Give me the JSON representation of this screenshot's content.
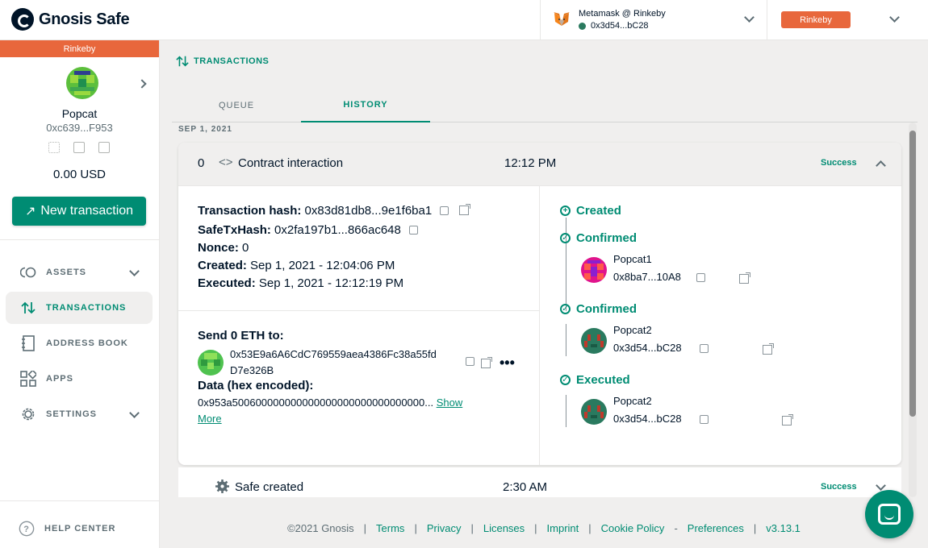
{
  "header": {
    "brand": "Gnosis Safe",
    "wallet_name": "Metamask @ Rinkeby",
    "wallet_address": "0x3d54...bC28",
    "network_badge": "Rinkeby"
  },
  "sidebar": {
    "network": "Rinkeby",
    "safe_name": "Popcat",
    "safe_address": "0xc639...F953",
    "balance": "0.00 USD",
    "new_tx_label": "New transaction",
    "nav": [
      {
        "label": "ASSETS"
      },
      {
        "label": "TRANSACTIONS"
      },
      {
        "label": "ADDRESS BOOK"
      },
      {
        "label": "APPS"
      },
      {
        "label": "SETTINGS"
      }
    ],
    "help": "HELP CENTER"
  },
  "main": {
    "section_title": "TRANSACTIONS",
    "tabs": [
      {
        "label": "QUEUE"
      },
      {
        "label": "HISTORY"
      }
    ],
    "date": "SEP 1, 2021",
    "tx": {
      "nonce": "0",
      "type": "Contract interaction",
      "time": "12:12 PM",
      "status": "Success",
      "details": {
        "hash_label": "Transaction hash:",
        "hash": "0x83d81db8...9e1f6ba1",
        "safetx_label": "SafeTxHash:",
        "safetx": "0x2fa197b1...866ac648",
        "nonce_label": "Nonce:",
        "nonce": "0",
        "created_label": "Created:",
        "created": "Sep 1, 2021 - 12:04:06 PM",
        "executed_label": "Executed:",
        "executed": "Sep 1, 2021 - 12:12:19 PM"
      },
      "send_label": "Send 0 ETH to:",
      "recipient": "0x53E9a6A6CdC769559aea4386Fc38a55fd",
      "recipient_tail": "D7e326B",
      "data_label": "Data (hex encoded):",
      "data_value": "0x953a500600000000000000000000000000000...",
      "show_label": "Show",
      "more_label": "More",
      "timeline": [
        {
          "title": "Created"
        },
        {
          "title": "Confirmed",
          "owner": "Popcat1",
          "address": "0x8ba7...10A8"
        },
        {
          "title": "Confirmed",
          "owner": "Popcat2",
          "address": "0x3d54...bC28"
        },
        {
          "title": "Executed",
          "owner": "Popcat2",
          "address": "0x3d54...bC28"
        }
      ]
    },
    "tx2": {
      "type": "Safe created",
      "time": "2:30 AM",
      "status": "Success"
    }
  },
  "footer": {
    "copyright": "©2021 Gnosis",
    "links": [
      "Terms",
      "Privacy",
      "Licenses",
      "Imprint",
      "Cookie Policy",
      "Preferences"
    ],
    "version": "v3.13.1"
  }
}
